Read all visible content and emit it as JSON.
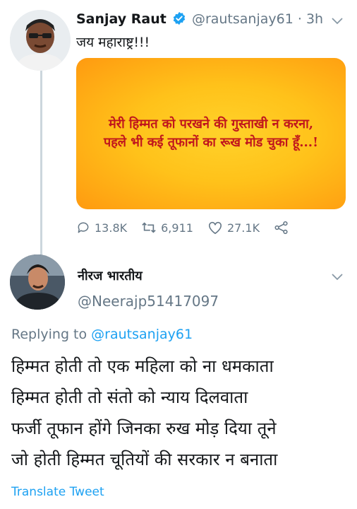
{
  "tweet": {
    "author_name": "Sanjay Raut",
    "author_handle": "@rautsanjay61",
    "time_sep": "·",
    "time": "3h",
    "text": "जय महाराष्ट्र!!!",
    "quote_lines": [
      "मेरी हिम्मत को परखने की गुस्ताखी न करना,",
      "पहले भी कई तूफानों का रूख मोड चुका हूँ...!"
    ],
    "stats": {
      "replies": "13.8K",
      "retweets": "6,911",
      "likes": "27.1K"
    }
  },
  "reply": {
    "author_name": "नीरज भारतीय",
    "author_handle": "@Neerajp51417097",
    "replying_prefix": "Replying to",
    "replying_to": "@rautsanjay61",
    "lines": [
      "हिम्मत होती तो एक महिला को ना धमकाता",
      "हिम्मत होती तो संतो को न्याय दिलवाता",
      "फर्जी तूफान होंगे जिनका रुख मोड़ दिया तूने",
      "जो होती हिम्मत चूतियों की सरकार न बनाता"
    ],
    "translate_label": "Translate Tweet"
  },
  "colors": {
    "accent": "#1da1f2",
    "muted": "#657786",
    "quote_text": "#c0151d",
    "card_bg": "#ffc21a"
  }
}
